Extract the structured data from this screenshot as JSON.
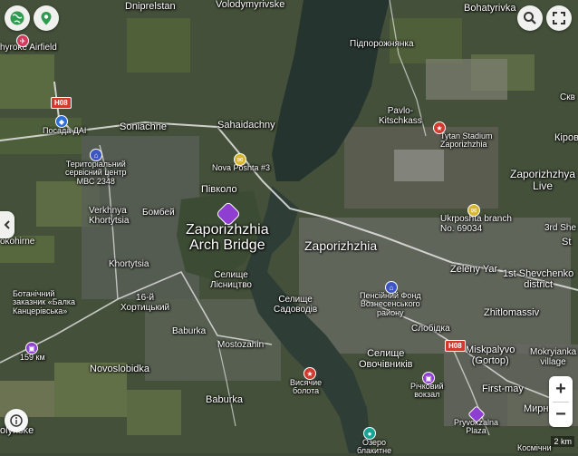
{
  "map": {
    "labels": [
      {
        "id": "dniprelstan",
        "text": "Dniprelstan"
      },
      {
        "id": "volodymyrivske",
        "text": "Volodymyrivske"
      },
      {
        "id": "bohatyrivka",
        "text": "Bohatyrivka"
      },
      {
        "id": "hyroke-airfield",
        "text": "hyroke Airfield"
      },
      {
        "id": "pidporozhnianka",
        "text": "Підпорожнянка"
      },
      {
        "id": "pavlo-kitschkass",
        "text": "Pavlo-\nKitschkass"
      },
      {
        "id": "skv",
        "text": "Скв"
      },
      {
        "id": "soniachne",
        "text": "Soniachne"
      },
      {
        "id": "sahaidachny",
        "text": "Sahaidachny"
      },
      {
        "id": "posada-dai",
        "text": "Посада ДАІ"
      },
      {
        "id": "tytan-stadium",
        "text": "Tytan Stadium\nZaporizhzhia"
      },
      {
        "id": "kirov",
        "text": "Кіров"
      },
      {
        "id": "service-center",
        "text": "Територіальний\nсервісний центр\nМВС 2348"
      },
      {
        "id": "nova-poshta",
        "text": "Nova Poshta #3"
      },
      {
        "id": "zaporizhzhya-live",
        "text": "Zaporizhzhya\nLive"
      },
      {
        "id": "pivkolo",
        "text": "Півколо"
      },
      {
        "id": "verkhnya-khortytsia",
        "text": "Verkhnya\nKhortytsia"
      },
      {
        "id": "bombei",
        "text": "Бомбей"
      },
      {
        "id": "arch-bridge",
        "text": "Zaporizhzhia\nArch Bridge"
      },
      {
        "id": "ukrposhta",
        "text": "Ukrposhta branch\nNo. 69034"
      },
      {
        "id": "3rd-she",
        "text": "3rd She"
      },
      {
        "id": "kokhirne",
        "text": "okohirne"
      },
      {
        "id": "zaporizhzhia",
        "text": "Zaporizhzhia"
      },
      {
        "id": "st",
        "text": "St"
      },
      {
        "id": "khortytsia",
        "text": "Khortytsia"
      },
      {
        "id": "zeleny-yar",
        "text": "Zeleny Yar"
      },
      {
        "id": "shevchenko",
        "text": "1st Shevchenko\ndistrict"
      },
      {
        "id": "selyshche-lisnytstvo",
        "text": "Селище\nЛісництво"
      },
      {
        "id": "botanical-reserve",
        "text": "Ботанічний\nзаказник «Балка\nКанцерівська»"
      },
      {
        "id": "16-khortytskyi",
        "text": "16-й\nХортицький"
      },
      {
        "id": "selyshche-sadovodiv",
        "text": "Селище\nСадоводів"
      },
      {
        "id": "pension-fund",
        "text": "Пенсійний Фонд\nВознесенського\nрайону"
      },
      {
        "id": "zhitlomassiv",
        "text": "Zhitlomassiv"
      },
      {
        "id": "slobidka",
        "text": "Слобідка"
      },
      {
        "id": "baburka-1",
        "text": "Baburka"
      },
      {
        "id": "mostozahin",
        "text": "Mostozahin"
      },
      {
        "id": "miskpalyvo",
        "text": "Miskpalyvo\n(Gortop)"
      },
      {
        "id": "mokrianka",
        "text": "Mokryianka\nvillage"
      },
      {
        "id": "159km",
        "text": "159 км"
      },
      {
        "id": "novoslobidka",
        "text": "Novoslobidka"
      },
      {
        "id": "selyshche-ovochivnykiv",
        "text": "Селище\nОвочівників"
      },
      {
        "id": "vysiache-bolota",
        "text": "Висячие\nболота"
      },
      {
        "id": "richkovyi-vokzal",
        "text": "Річковий\nвокзал"
      },
      {
        "id": "first-may",
        "text": "First-may"
      },
      {
        "id": "baburka-2",
        "text": "Baburka"
      },
      {
        "id": "myrne",
        "text": "Мирн"
      },
      {
        "id": "pryvokzalna-plaza",
        "text": "Pryvokzalna\nPlaza"
      },
      {
        "id": "ozero",
        "text": "Озеро\nблакитне"
      },
      {
        "id": "olynske",
        "text": "olynske"
      },
      {
        "id": "kosmichnyi",
        "text": "Космічни"
      }
    ],
    "road_shields": [
      {
        "id": "h08-north",
        "text": "H08"
      },
      {
        "id": "h08-south",
        "text": "H08"
      }
    ],
    "scale_label": "2 km",
    "colors": {
      "water": "#2b3a35",
      "river": "#34423c",
      "road": "#e8e8e8",
      "highway": "#f2f2f2",
      "accent_pin": "#8e3fd1"
    }
  },
  "controls": {
    "globe_icon": "globe-icon",
    "location_icon": "location-icon",
    "search_icon": "search-icon",
    "expand_icon": "expand-icon",
    "collapse_icon": "chevron-left-icon",
    "zoom_in": "+",
    "zoom_out": "−"
  }
}
